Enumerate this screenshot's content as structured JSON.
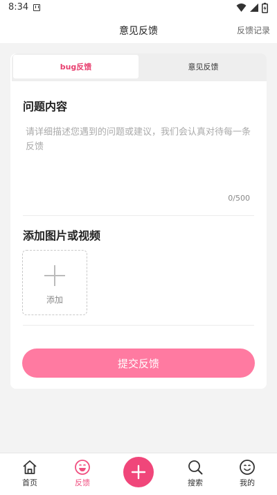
{
  "status_bar": {
    "time": "8:34"
  },
  "header": {
    "title": "意见反馈",
    "record_link": "反馈记录"
  },
  "tabs": [
    {
      "label": "bug反馈",
      "active": true
    },
    {
      "label": "意见反馈",
      "active": false
    }
  ],
  "content_section": {
    "title": "问题内容",
    "placeholder": "请详细描述您遇到的问题或建议，我们会认真对待每一条反馈",
    "value": "",
    "counter": "0/500"
  },
  "media_section": {
    "title": "添加图片或视频",
    "add_label": "添加"
  },
  "submit_label": "提交反馈",
  "bottom_nav": [
    {
      "label": "首页",
      "icon": "home-icon",
      "active": false
    },
    {
      "label": "反馈",
      "icon": "smile-icon",
      "active": true
    },
    {
      "label": "",
      "icon": "plus-icon",
      "active": false
    },
    {
      "label": "搜索",
      "icon": "search-icon",
      "active": false
    },
    {
      "label": "我的",
      "icon": "profile-smile-icon",
      "active": false
    }
  ],
  "colors": {
    "accent": "#f0467a",
    "submit_button": "#ff7aa1",
    "active_tab_text": "#e83f6f",
    "background": "#f3f3f3"
  }
}
